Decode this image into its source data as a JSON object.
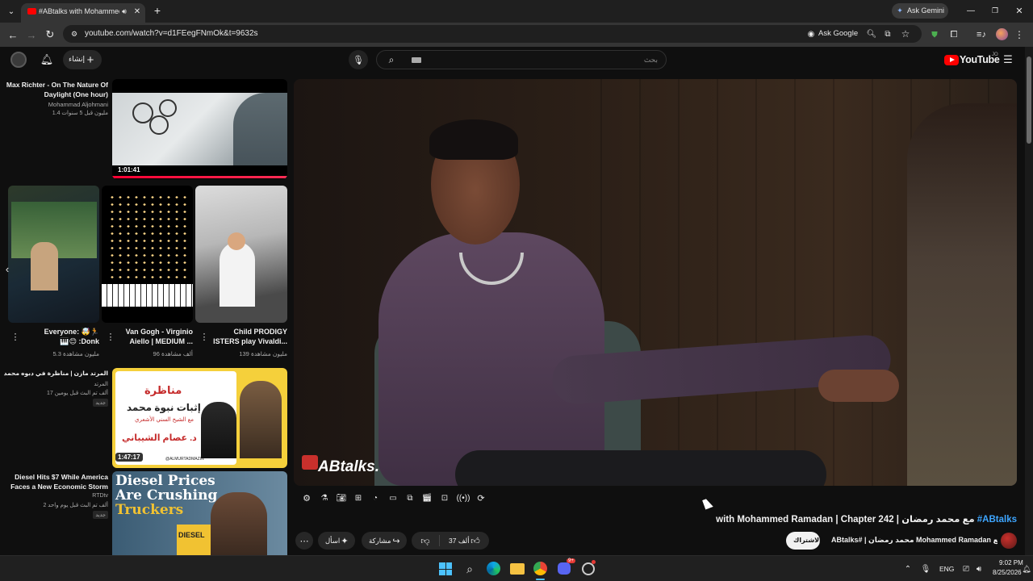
{
  "browser": {
    "tab_title": "#ABtalks with Mohammed",
    "url": "youtube.com/watch?v=d1FEegFNmOk&t=9632s",
    "ask_gemini": "Ask Gemini",
    "ask_google": "Ask Google"
  },
  "header": {
    "create_label": "إنشاء",
    "search_placeholder": "بحث",
    "logo_text": "YouTube",
    "logo_sup": "JO"
  },
  "sidebar_top": {
    "title_line1": "Max Richter - On The Nature Of",
    "title_line2": "Daylight (One hour)",
    "channel": "Mohammad Aljohmani",
    "meta": "1.4 مليون  قبل 5 سنوات",
    "duration": "1:01:41"
  },
  "shorts": [
    {
      "title_line1": "Everyone: 🤯🏃",
      "title_line2": "🎹😊 :Donk",
      "views": "5.3 مليون مشاهدة"
    },
    {
      "title_line1": "Van Gogh - Virginio",
      "title_line2": "Aiello | MEDIUM ...",
      "views": "96 ألف مشاهدة"
    },
    {
      "title_line1": "Child PRODIGY",
      "title_line2": "ISTERS play Vivaldi...",
      "views": "139 مليون مشاهدة"
    }
  ],
  "recommended": [
    {
      "title": "المرتد مازن | مناظرة في دبوه محمد",
      "channel": "المرتد",
      "meta": "17 ألف  تم البث قبل يومين",
      "badge": "جديد",
      "duration": "1:47:17",
      "thumb_heading": "مناظرة",
      "thumb_sub": "إثبات نبوة محمد",
      "thumb_sub2": "مع الشيخ السني الأشعري",
      "thumb_name": "د. عصام الشيباني",
      "thumb_handle": "@ALMURTADMAZIN"
    },
    {
      "title_line1": "Diesel Hits $7 While America",
      "title_line2": "Faces a New Economic Storm",
      "channel": "RTDtv",
      "meta": "2 ألف  تم البث قبل يوم واحد",
      "badge": "جديد",
      "thumb_text_line1": "Diesel Prices",
      "thumb_text_line2": "Are Crushing",
      "thumb_text_line3": "Truckers",
      "thumb_sign": "DIESEL"
    }
  ],
  "video": {
    "watermark": "ABtalks.",
    "title_hashtag": "#ABtalks",
    "title_rest": "with Mohammed Ramadan | Chapter 242 | مع محمد رمضان",
    "channel_line": "ABtalks# | محمد رمضان Mohammed Ramadan مع",
    "subscribe": "الاشتراك",
    "likes": "37 ألف",
    "share": "مشاركة",
    "ask": "اسأل"
  },
  "taskbar": {
    "lang": "ENG",
    "time": "9:02 PM",
    "date": "8/25/2026",
    "discord_badge": "9+"
  },
  "colors": {
    "youtube_red": "#ff0000",
    "hashtag_blue": "#3ea6ff",
    "background": "#0f0f0f"
  }
}
